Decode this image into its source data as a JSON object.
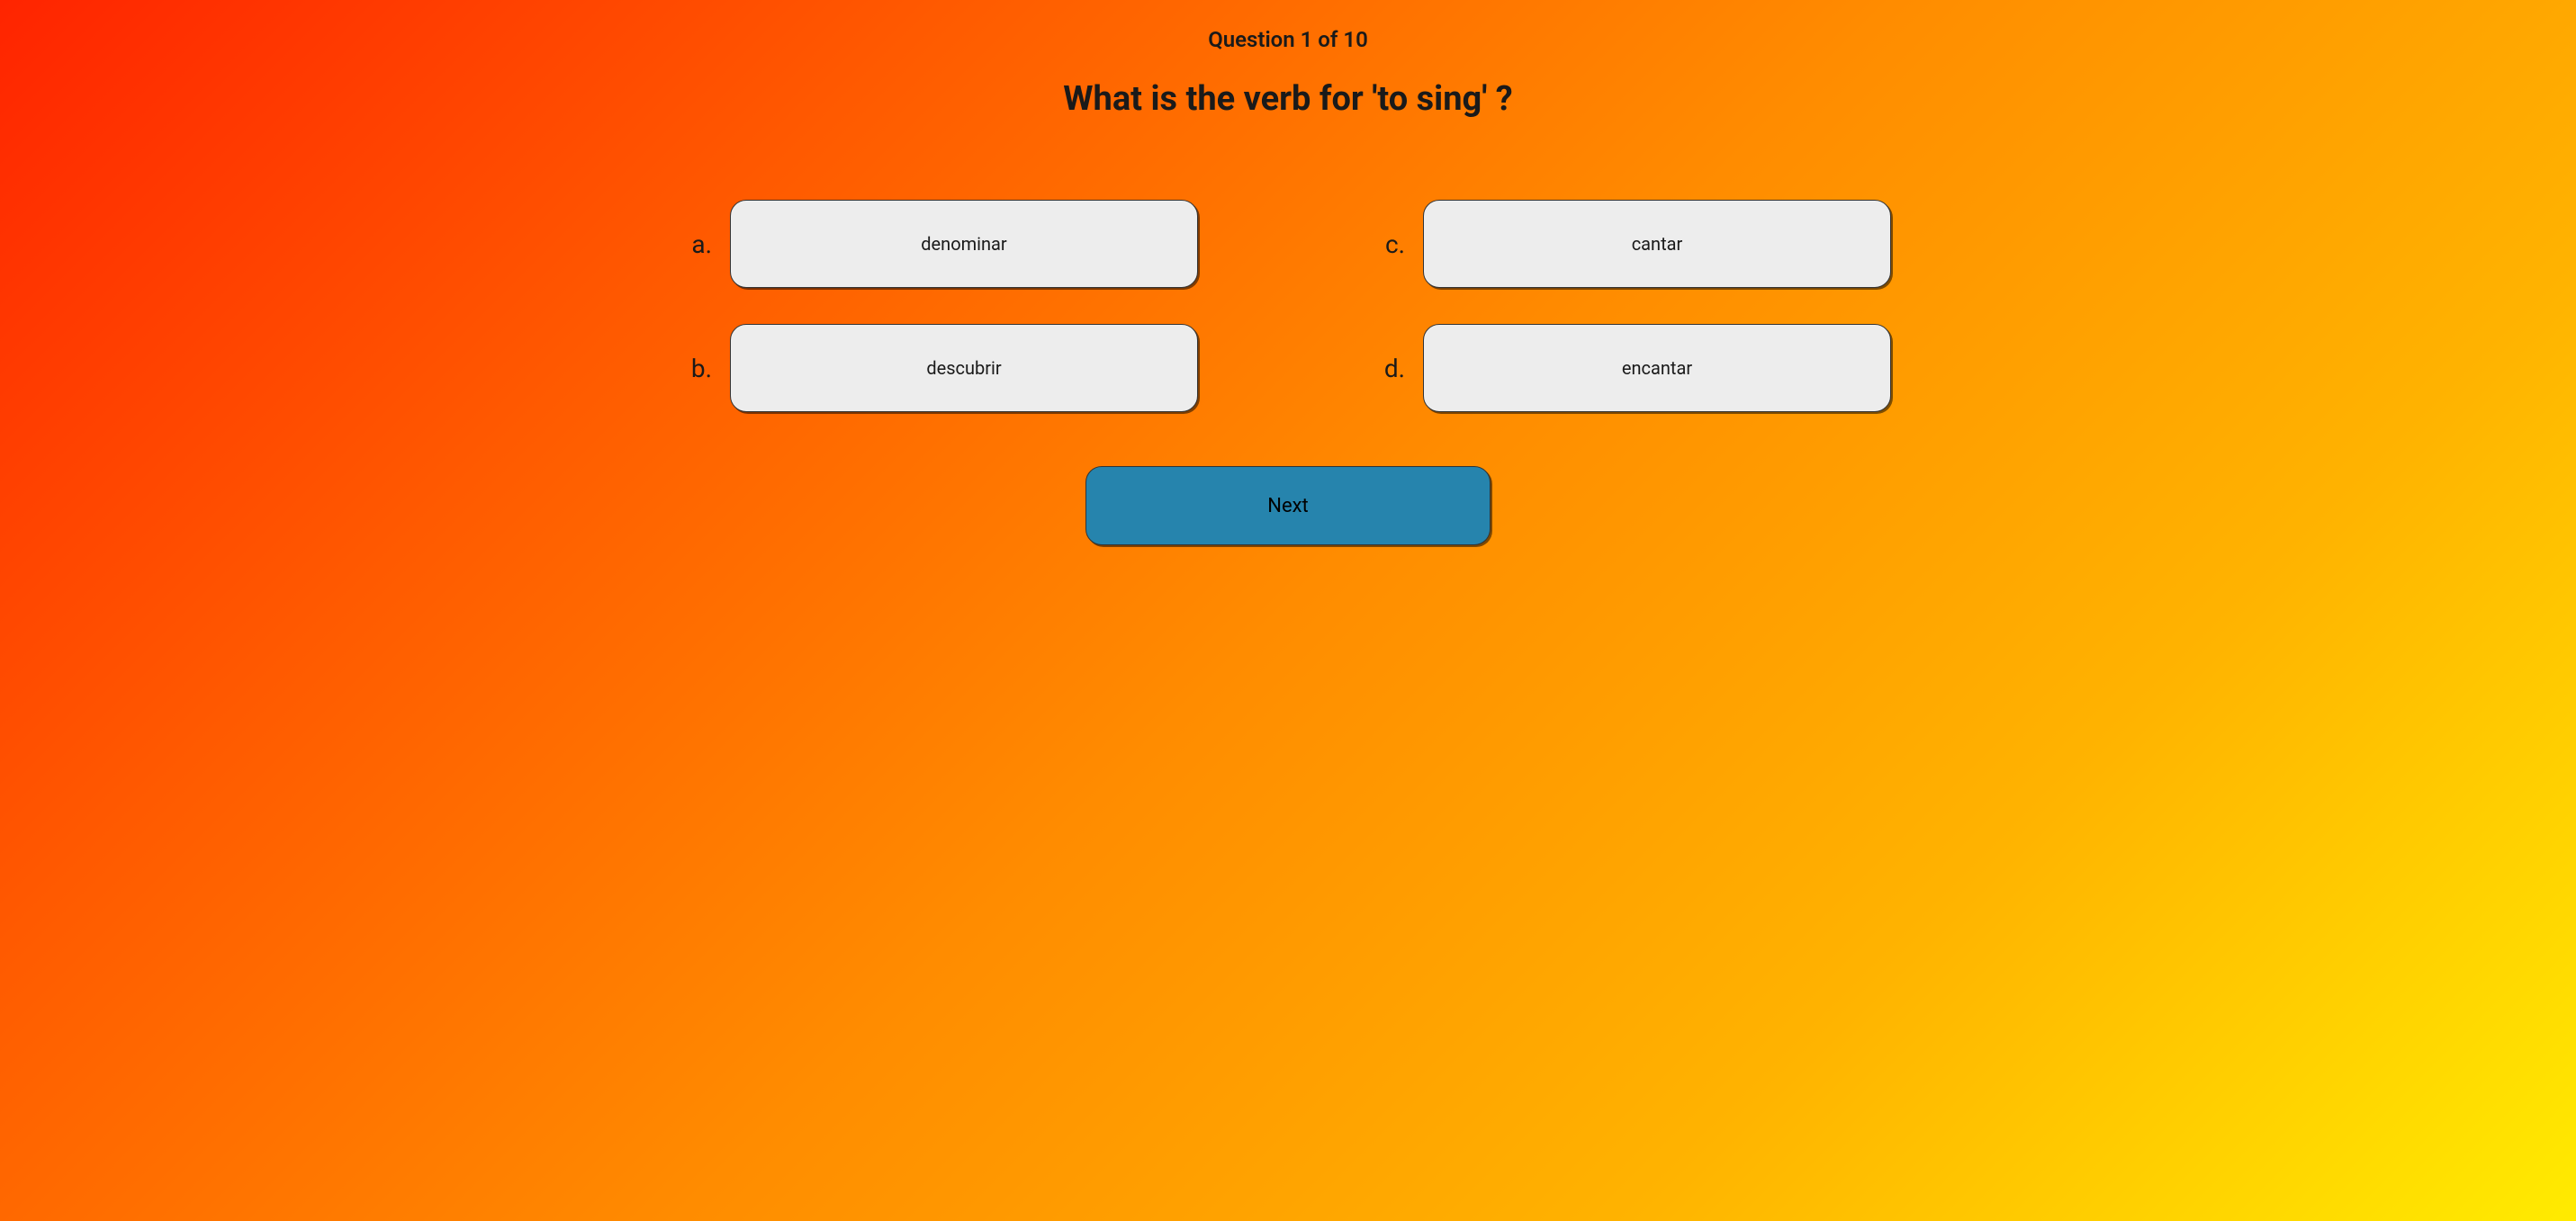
{
  "header": {
    "counter": "Question 1 of 10"
  },
  "question": {
    "text": "What is the verb for 'to sing' ?"
  },
  "answers": [
    {
      "letter": "a.",
      "text": "denominar"
    },
    {
      "letter": "b.",
      "text": "descubrir"
    },
    {
      "letter": "c.",
      "text": "cantar"
    },
    {
      "letter": "d.",
      "text": "encantar"
    }
  ],
  "controls": {
    "next_label": "Next"
  }
}
